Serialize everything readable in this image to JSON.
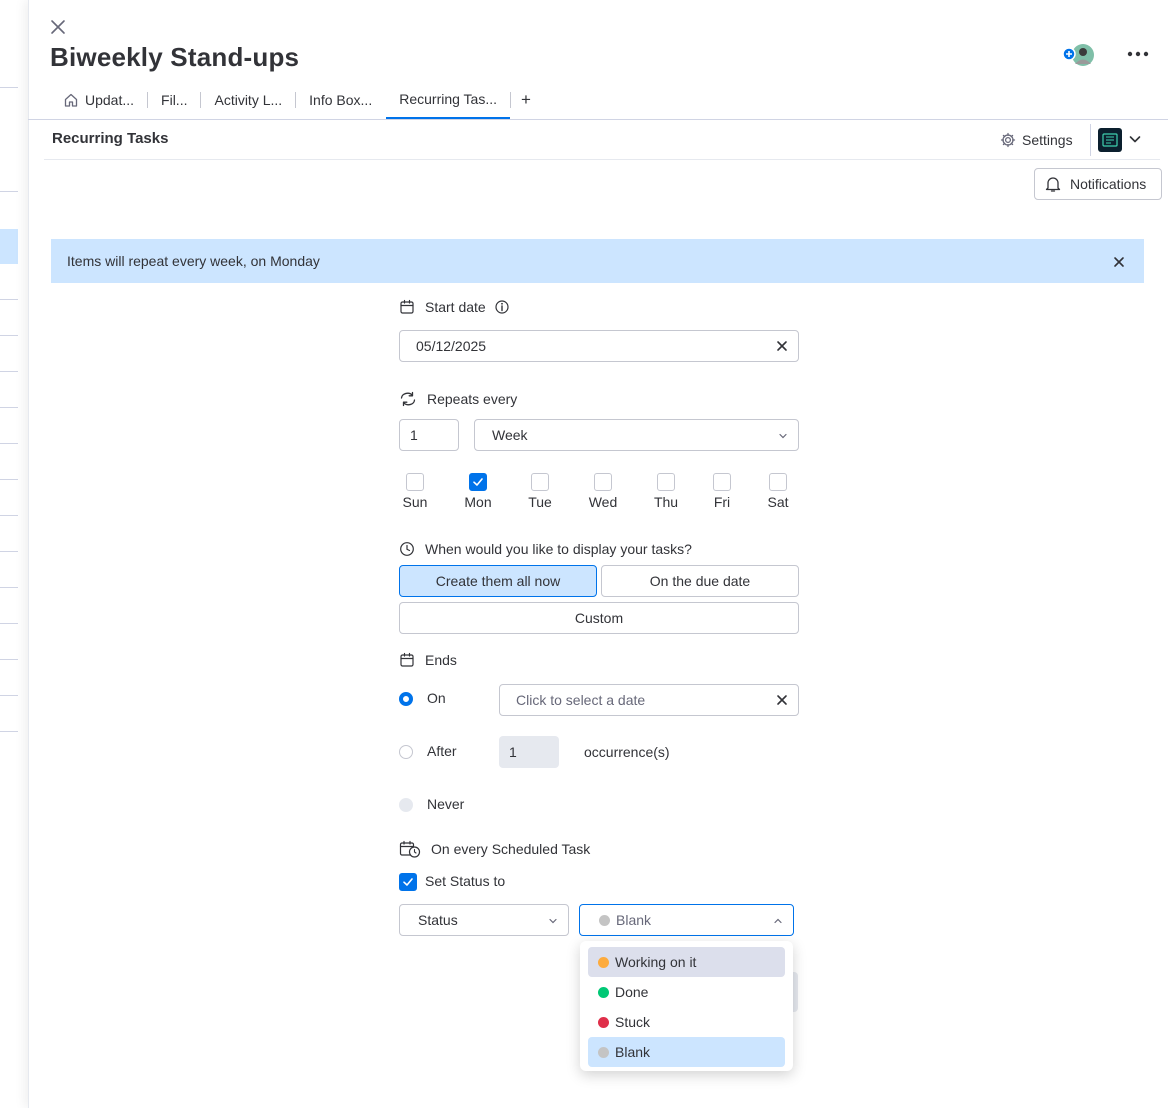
{
  "header": {
    "title": "Biweekly Stand-ups",
    "more_label": "•••"
  },
  "tabs": [
    {
      "label": "Updat...",
      "icon": "home-icon"
    },
    {
      "label": "Fil..."
    },
    {
      "label": "Activity L..."
    },
    {
      "label": "Info Box..."
    },
    {
      "label": "Recurring Tas...",
      "active": true
    }
  ],
  "tab_add_label": "+",
  "view": {
    "title": "Recurring Tasks",
    "settings_label": "Settings",
    "notifications_label": "Notifications"
  },
  "banner": {
    "text": "Items will repeat every week, on Monday"
  },
  "start_date": {
    "label": "Start date",
    "value": "05/12/2025"
  },
  "repeats": {
    "label": "Repeats every",
    "count": "1",
    "unit": "Week"
  },
  "days": [
    {
      "label": "Sun",
      "checked": false
    },
    {
      "label": "Mon",
      "checked": true
    },
    {
      "label": "Tue",
      "checked": false
    },
    {
      "label": "Wed",
      "checked": false
    },
    {
      "label": "Thu",
      "checked": false
    },
    {
      "label": "Fri",
      "checked": false
    },
    {
      "label": "Sat",
      "checked": false
    }
  ],
  "display": {
    "question": "When would you like to display your tasks?",
    "option_create_now": "Create them all now",
    "option_due_date": "On the due date",
    "option_custom": "Custom"
  },
  "ends": {
    "label": "Ends",
    "on_label": "On",
    "on_placeholder": "Click to select a date",
    "after_label": "After",
    "after_value": "1",
    "occurrences_label": "occurrence(s)",
    "never_label": "Never"
  },
  "scheduled": {
    "label": "On every Scheduled Task",
    "set_status_label": "Set Status to",
    "column_select": "Status",
    "value_select": "Blank"
  },
  "status_options": [
    {
      "label": "Working on it",
      "color": "#fdab3d"
    },
    {
      "label": "Done",
      "color": "#00c875"
    },
    {
      "label": "Stuck",
      "color": "#df2f4a"
    },
    {
      "label": "Blank",
      "color": "#c4c4c4"
    }
  ],
  "colors": {
    "accent": "#0073ea",
    "selected_bg": "#cce5ff"
  }
}
